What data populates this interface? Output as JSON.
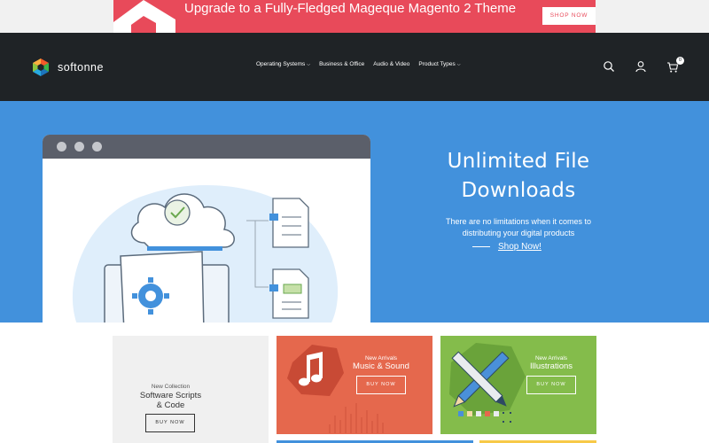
{
  "promo": {
    "text": "Upgrade to a Fully-Fledged Mageque Magento 2 Theme",
    "button_label": "SHOP NOW"
  },
  "header": {
    "brand": "softonne",
    "nav": [
      {
        "label": "Operating Systems",
        "has_dropdown": true
      },
      {
        "label": "Business & Office",
        "has_dropdown": false
      },
      {
        "label": "Audio & Video",
        "has_dropdown": false
      },
      {
        "label": "Product Types",
        "has_dropdown": true
      }
    ],
    "icons": [
      "search-icon",
      "user-icon",
      "cart-icon"
    ],
    "cart_count": "0"
  },
  "hero": {
    "title": "Unlimited File Downloads",
    "subtitle": "There are no limitations when it comes to distributing your digital products",
    "cta": "Shop Now!"
  },
  "tiles": [
    {
      "kicker": "New Collection",
      "title": "Software Scripts & Code",
      "button": "BUY NOW",
      "color": "#f0f0f0"
    },
    {
      "kicker": "New Arrivals",
      "title": "Music & Sound",
      "button": "BUY NOW",
      "color": "#e5684d"
    },
    {
      "kicker": "New Arrivals",
      "title": "Illustrations",
      "button": "BUY NOW",
      "color": "#84bc4b"
    }
  ],
  "colors": {
    "promo": "#e84a5a",
    "header": "#1f2326",
    "hero": "#4291dc"
  }
}
